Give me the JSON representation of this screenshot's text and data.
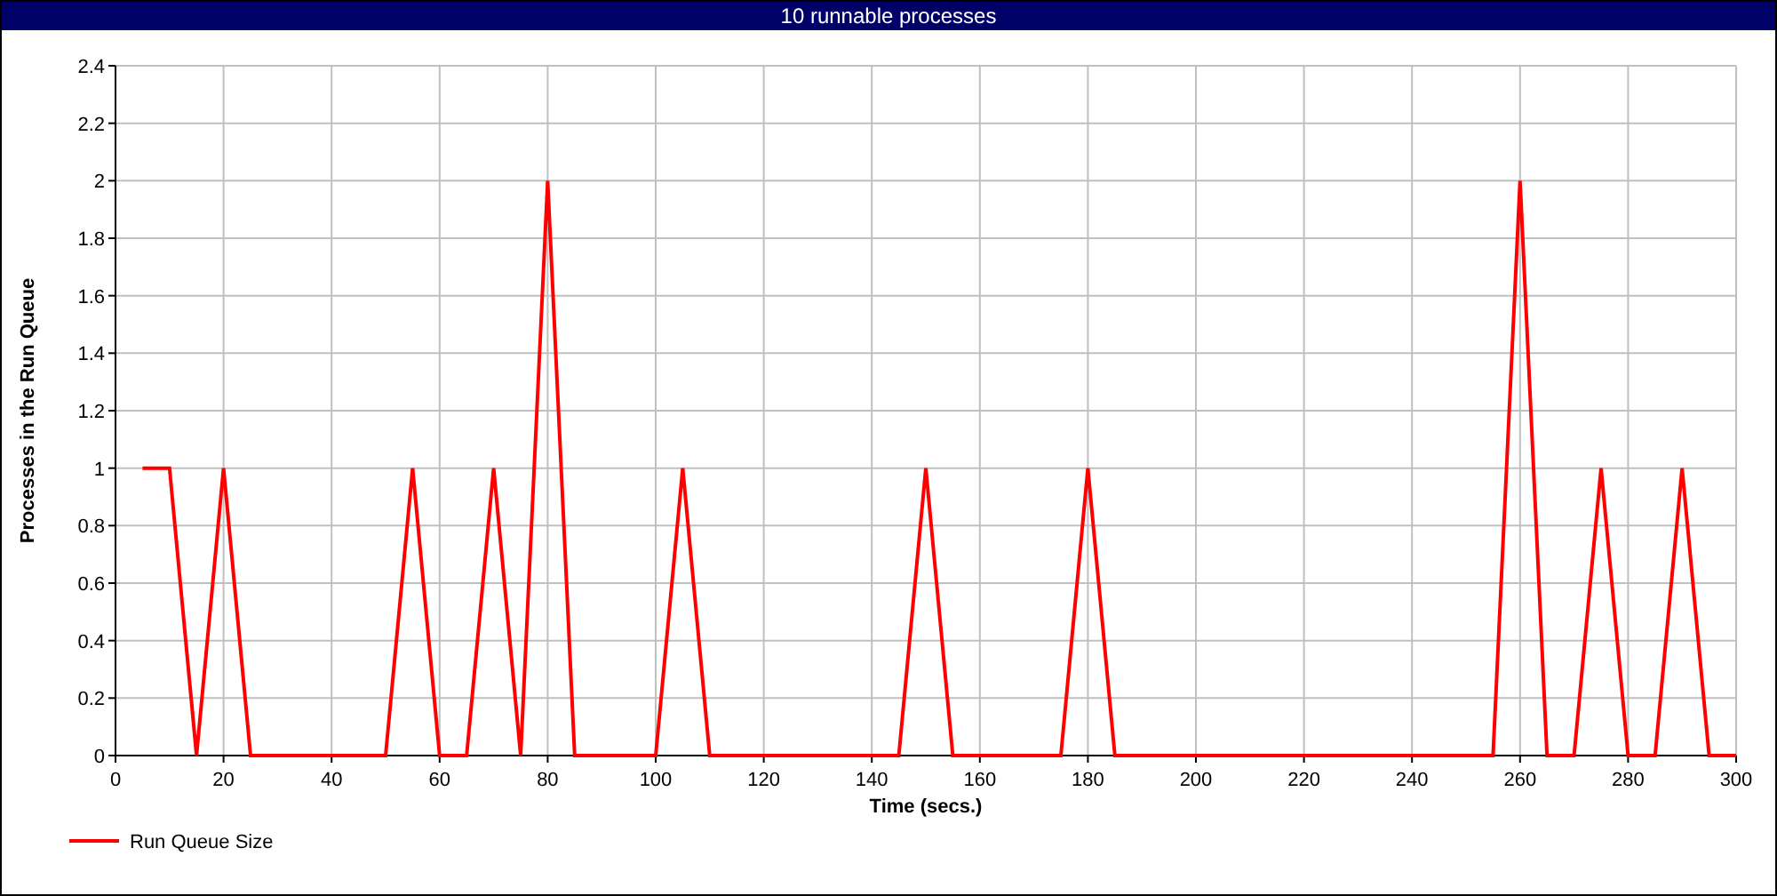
{
  "chart_data": {
    "type": "line",
    "title": "10 runnable processes",
    "xlabel": "Time (secs.)",
    "ylabel": "Processes in the Run Queue",
    "x": [
      5,
      10,
      15,
      20,
      25,
      30,
      35,
      40,
      45,
      50,
      55,
      60,
      65,
      70,
      75,
      80,
      85,
      90,
      95,
      100,
      105,
      110,
      115,
      120,
      125,
      130,
      135,
      140,
      145,
      150,
      155,
      160,
      165,
      170,
      175,
      180,
      185,
      190,
      195,
      200,
      205,
      210,
      215,
      220,
      225,
      230,
      235,
      240,
      245,
      250,
      255,
      260,
      265,
      270,
      275,
      280,
      285,
      290,
      295,
      300
    ],
    "series": [
      {
        "name": "Run Queue Size",
        "color": "#ff0000",
        "values": [
          1,
          1,
          0,
          1,
          0,
          0,
          0,
          0,
          0,
          0,
          1,
          0,
          0,
          1,
          0,
          2,
          0,
          0,
          0,
          0,
          1,
          0,
          0,
          0,
          0,
          0,
          0,
          0,
          0,
          1,
          0,
          0,
          0,
          0,
          0,
          1,
          0,
          0,
          0,
          0,
          0,
          0,
          0,
          0,
          0,
          0,
          0,
          0,
          0,
          0,
          0,
          2,
          0,
          0,
          1,
          0,
          0,
          1,
          0,
          0
        ]
      }
    ],
    "grid": true,
    "xlim": [
      0,
      300
    ],
    "ylim": [
      0,
      2.4
    ],
    "xticks": [
      0,
      20,
      40,
      60,
      80,
      100,
      120,
      140,
      160,
      180,
      200,
      220,
      240,
      260,
      280,
      300
    ],
    "yticks": [
      0,
      0.2,
      0.4,
      0.6,
      0.8,
      1,
      1.2,
      1.4,
      1.6,
      1.8,
      2,
      2.2,
      2.4
    ]
  }
}
